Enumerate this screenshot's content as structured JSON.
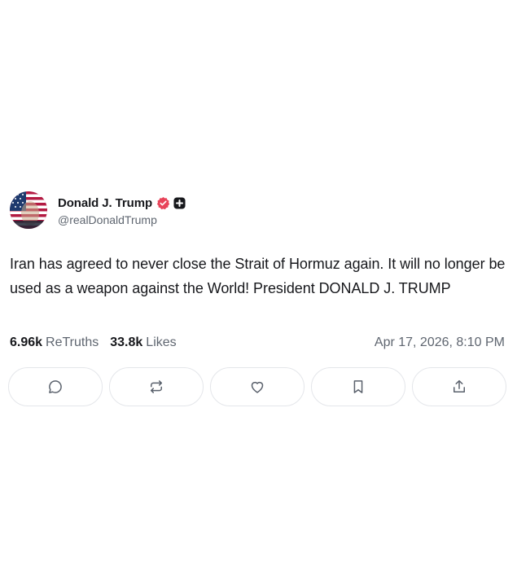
{
  "author": {
    "display_name": "Donald J. Trump",
    "handle": "@realDonaldTrump"
  },
  "post": {
    "text": "Iran has agreed to never close the Strait of Hormuz again. It will no longer be used as a weapon against the World! President DONALD J. TRUMP",
    "retruths_count": "6.96k",
    "retruths_label": "ReTruths",
    "likes_count": "33.8k",
    "likes_label": "Likes",
    "timestamp": "Apr 17, 2026, 8:10 PM"
  },
  "actions": [
    {
      "icon": "reply-icon"
    },
    {
      "icon": "retruth-icon"
    },
    {
      "icon": "like-icon"
    },
    {
      "icon": "bookmark-icon"
    },
    {
      "icon": "share-icon"
    }
  ],
  "colors": {
    "verified_badge": "#e8445a",
    "text_primary": "#17181c",
    "text_secondary": "#5f6670",
    "button_border": "#e4e6ea"
  }
}
